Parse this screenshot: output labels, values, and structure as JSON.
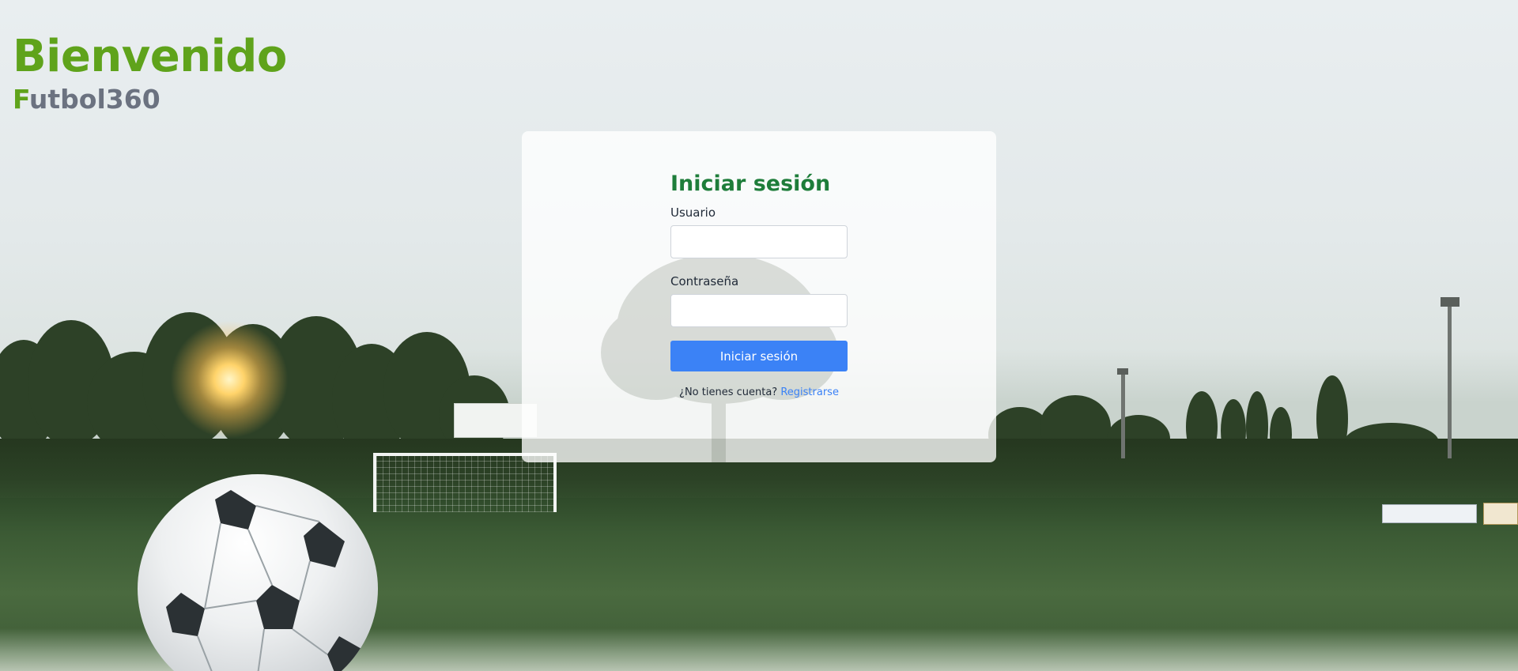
{
  "header": {
    "title": "Bienvenido",
    "brand_initial": "F",
    "brand_rest": "utbol360"
  },
  "login": {
    "heading": "Iniciar sesión",
    "username_label": "Usuario",
    "username_value": "",
    "password_label": "Contraseña",
    "password_value": "",
    "submit_label": "Iniciar sesión",
    "no_account_text": "¿No tienes cuenta?",
    "register_link": "Registrarse"
  },
  "colors": {
    "brand_green": "#5fa31b",
    "heading_green": "#1e7d3a",
    "primary_blue": "#3b82f6",
    "brand_gray": "#6b7280"
  },
  "background": {
    "description_icon": "soccer-field-background"
  }
}
